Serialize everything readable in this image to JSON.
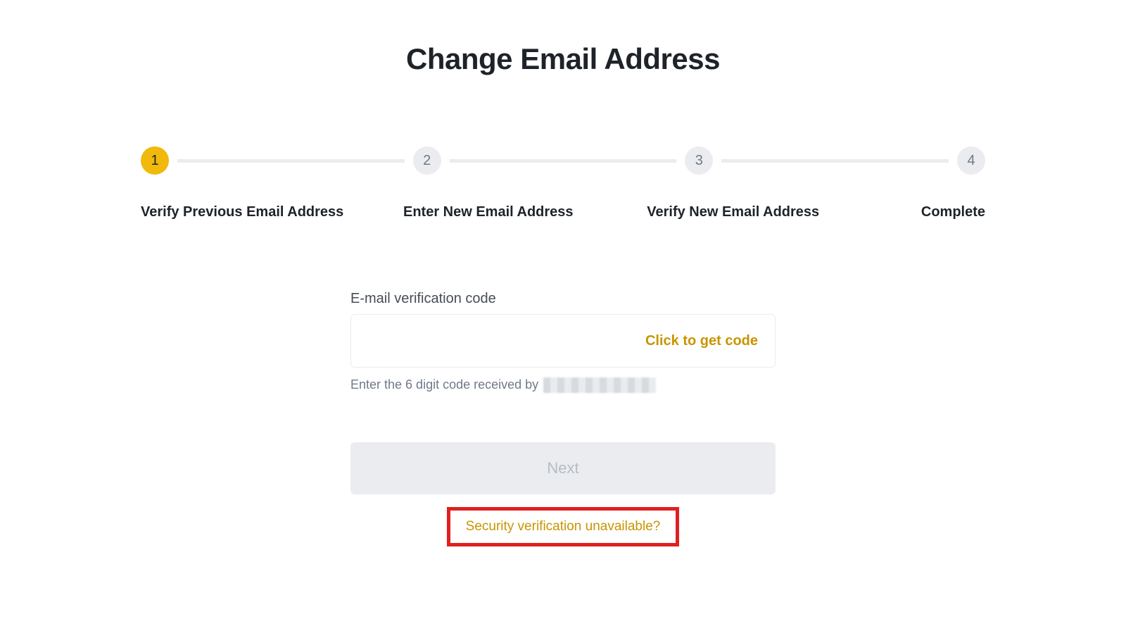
{
  "title": "Change Email Address",
  "stepper": {
    "steps": [
      {
        "num": "1",
        "label": "Verify Previous Email Address",
        "active": true
      },
      {
        "num": "2",
        "label": "Enter New Email Address",
        "active": false
      },
      {
        "num": "3",
        "label": "Verify New Email Address",
        "active": false
      },
      {
        "num": "4",
        "label": "Complete",
        "active": false
      }
    ]
  },
  "form": {
    "field_label": "E-mail verification code",
    "get_code_label": "Click to get code",
    "helper_prefix": "Enter the 6 digit code received by ",
    "next_label": "Next",
    "security_link": "Security verification unavailable?"
  },
  "colors": {
    "accent": "#f0b90b",
    "link": "#c99400",
    "highlight_border": "#e02020"
  }
}
